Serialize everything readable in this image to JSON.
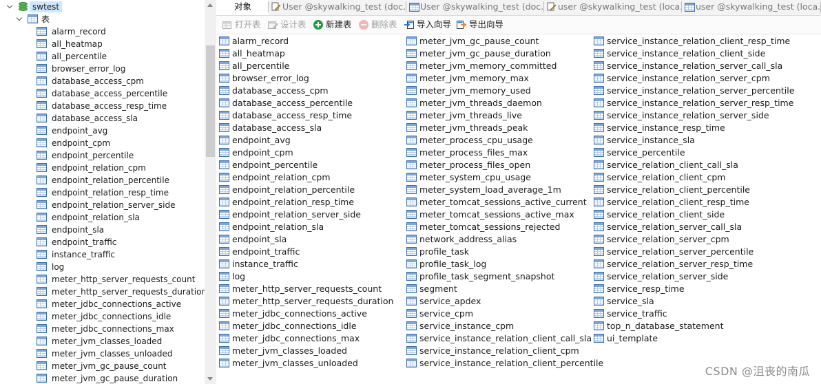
{
  "tree": {
    "database": "swtest",
    "group_label": "表",
    "tables": [
      "alarm_record",
      "all_heatmap",
      "all_percentile",
      "browser_error_log",
      "database_access_cpm",
      "database_access_percentile",
      "database_access_resp_time",
      "database_access_sla",
      "endpoint_avg",
      "endpoint_cpm",
      "endpoint_percentile",
      "endpoint_relation_cpm",
      "endpoint_relation_percentile",
      "endpoint_relation_resp_time",
      "endpoint_relation_server_side",
      "endpoint_relation_sla",
      "endpoint_sla",
      "endpoint_traffic",
      "instance_traffic",
      "log",
      "meter_http_server_requests_count",
      "meter_http_server_requests_duration",
      "meter_jdbc_connections_active",
      "meter_jdbc_connections_idle",
      "meter_jdbc_connections_max",
      "meter_jvm_classes_loaded",
      "meter_jvm_classes_unloaded",
      "meter_jvm_gc_pause_count",
      "meter_jvm_gc_pause_duration"
    ]
  },
  "tabs": [
    {
      "label": "对象",
      "active": true,
      "icon": "none"
    },
    {
      "label": "User @skywalking_test (doc...",
      "active": false,
      "icon": "pencil-query-icon"
    },
    {
      "label": "User @skywalking_test (doc...",
      "active": false,
      "icon": "table-icon"
    },
    {
      "label": "user @skywalking_test (loca...",
      "active": false,
      "icon": "pencil-query-icon"
    },
    {
      "label": "user @skywalking_test (loca...",
      "active": false,
      "icon": "table-icon"
    }
  ],
  "toolbar": [
    {
      "label": "打开表",
      "icon": "open-table-icon",
      "enabled": false
    },
    {
      "label": "设计表",
      "icon": "design-table-icon",
      "enabled": false
    },
    {
      "label": "新建表",
      "icon": "new-table-icon",
      "enabled": true
    },
    {
      "label": "删除表",
      "icon": "delete-table-icon",
      "enabled": false
    },
    {
      "label": "导入向导",
      "icon": "import-wizard-icon",
      "enabled": true
    },
    {
      "label": "导出向导",
      "icon": "export-wizard-icon",
      "enabled": true
    }
  ],
  "objects": {
    "column_1": [
      "alarm_record",
      "all_heatmap",
      "all_percentile",
      "browser_error_log",
      "database_access_cpm",
      "database_access_percentile",
      "database_access_resp_time",
      "database_access_sla",
      "endpoint_avg",
      "endpoint_cpm",
      "endpoint_percentile",
      "endpoint_relation_cpm",
      "endpoint_relation_percentile",
      "endpoint_relation_resp_time",
      "endpoint_relation_server_side",
      "endpoint_relation_sla",
      "endpoint_sla",
      "endpoint_traffic",
      "instance_traffic",
      "log",
      "meter_http_server_requests_count",
      "meter_http_server_requests_duration",
      "meter_jdbc_connections_active",
      "meter_jdbc_connections_idle",
      "meter_jdbc_connections_max",
      "meter_jvm_classes_loaded",
      "meter_jvm_classes_unloaded"
    ],
    "column_2": [
      "meter_jvm_gc_pause_count",
      "meter_jvm_gc_pause_duration",
      "meter_jvm_memory_committed",
      "meter_jvm_memory_max",
      "meter_jvm_memory_used",
      "meter_jvm_threads_daemon",
      "meter_jvm_threads_live",
      "meter_jvm_threads_peak",
      "meter_process_cpu_usage",
      "meter_process_files_max",
      "meter_process_files_open",
      "meter_system_cpu_usage",
      "meter_system_load_average_1m",
      "meter_tomcat_sessions_active_current",
      "meter_tomcat_sessions_active_max",
      "meter_tomcat_sessions_rejected",
      "network_address_alias",
      "profile_task",
      "profile_task_log",
      "profile_task_segment_snapshot",
      "segment",
      "service_apdex",
      "service_cpm",
      "service_instance_cpm",
      "service_instance_relation_client_call_sla",
      "service_instance_relation_client_cpm",
      "service_instance_relation_client_percentile"
    ],
    "column_3": [
      "service_instance_relation_client_resp_time",
      "service_instance_relation_client_side",
      "service_instance_relation_server_call_sla",
      "service_instance_relation_server_cpm",
      "service_instance_relation_server_percentile",
      "service_instance_relation_server_resp_time",
      "service_instance_relation_server_side",
      "service_instance_resp_time",
      "service_instance_sla",
      "service_percentile",
      "service_relation_client_call_sla",
      "service_relation_client_cpm",
      "service_relation_client_percentile",
      "service_relation_client_resp_time",
      "service_relation_client_side",
      "service_relation_server_call_sla",
      "service_relation_server_cpm",
      "service_relation_server_percentile",
      "service_relation_server_resp_time",
      "service_relation_server_side",
      "service_resp_time",
      "service_sla",
      "service_traffic",
      "top_n_database_statement",
      "ui_template"
    ]
  },
  "watermark": "CSDN @沮丧的南瓜",
  "colors": {
    "selection": "#cde8ff",
    "database_icon": "#5bb65a",
    "table_icon": "#3b6fb0",
    "new_icon": "#1f9d3a",
    "delete_icon": "#e06060",
    "import_icon": "#2a7fd4",
    "export_icon": "#e8892b"
  }
}
